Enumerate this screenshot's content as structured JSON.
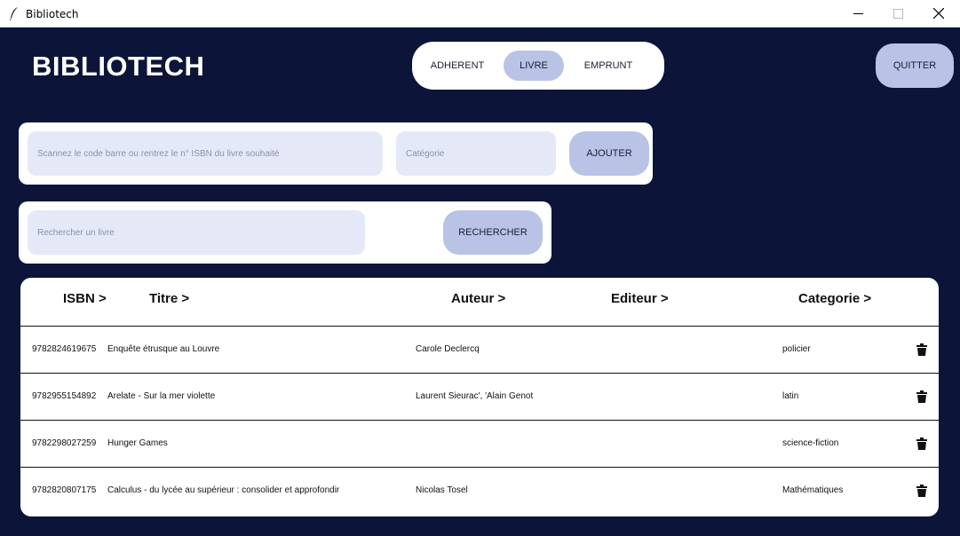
{
  "window": {
    "title": "Bibliotech",
    "icons": {
      "app": "feather-icon",
      "minimize": "minimize-icon",
      "maximize": "maximize-icon",
      "close": "close-icon"
    }
  },
  "header": {
    "brand": "BIBLIOTECH",
    "nav": {
      "adherent": "ADHERENT",
      "livre": "LIVRE",
      "emprunt": "EMPRUNT",
      "active": "LIVRE"
    },
    "quit_label": "QUITTER"
  },
  "add_form": {
    "isbn_placeholder": "Scannez le code barre ou rentrez le n° ISBN du livre souhaité",
    "category_placeholder": "Catégorie",
    "add_label": "AJOUTER"
  },
  "search_form": {
    "placeholder": "Rechercher un livre",
    "search_label": "RECHERCHER"
  },
  "table": {
    "headers": {
      "isbn": "ISBN >",
      "titre": "Titre >",
      "auteur": "Auteur >",
      "editeur": "Editeur >",
      "categorie": "Categorie >"
    },
    "rows": [
      {
        "isbn": "9782824619675",
        "titre": "Enquête étrusque au Louvre",
        "auteur": "Carole Declercq",
        "editeur": "",
        "categorie": "policier"
      },
      {
        "isbn": "9782955154892",
        "titre": "Arelate - Sur la mer violette",
        "auteur": "Laurent Sieurac', 'Alain Genot",
        "editeur": "",
        "categorie": "latin"
      },
      {
        "isbn": "9782298027259",
        "titre": "Hunger Games",
        "auteur": "",
        "editeur": "",
        "categorie": "science-fiction"
      },
      {
        "isbn": "9782820807175",
        "titre": "Calculus - du lycée au supérieur : consolider et approfondir",
        "auteur": "Nicolas Tosel",
        "editeur": "",
        "categorie": "Mathématiques"
      }
    ],
    "row_action_icon": "trash-icon"
  },
  "colors": {
    "background": "#0c1539",
    "accent": "#b8c3e6",
    "field": "#e5e9f7",
    "panel": "#ffffff"
  }
}
